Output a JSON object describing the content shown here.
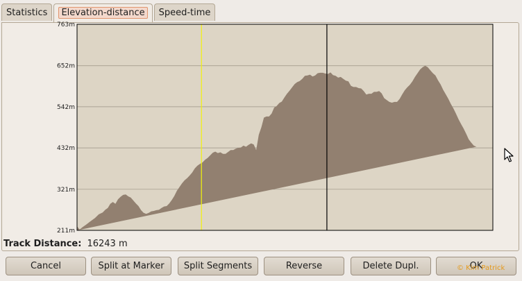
{
  "tabs": [
    {
      "label": "Statistics",
      "active": false
    },
    {
      "label": "Elevation-distance",
      "active": true
    },
    {
      "label": "Speed-time",
      "active": false
    }
  ],
  "track_distance": {
    "label": "Track Distance:",
    "value": "16243 m"
  },
  "buttons": {
    "cancel": "Cancel",
    "split_at_marker": "Split at Marker",
    "split_segments": "Split Segments",
    "reverse": "Reverse",
    "delete_dupl": "Delete Dupl.",
    "ok": "OK"
  },
  "watermark": "© Kim Patrick",
  "colors": {
    "plot_bg": "#ddd5c5",
    "fill": "#928070",
    "marker_yellow": "#f2f20c",
    "marker_black": "#000000"
  },
  "chart_data": {
    "type": "area",
    "y_tick_labels": [
      "763m",
      "652m",
      "542m",
      "432m",
      "321m",
      "211m"
    ],
    "y_ticks": [
      763,
      652,
      542,
      432,
      321,
      211
    ],
    "ylim": [
      211,
      763
    ],
    "xlim": [
      0,
      16243
    ],
    "grid": true,
    "markers": {
      "yellow": 4860,
      "black": 9760
    },
    "x": [
      0,
      100,
      200,
      350,
      500,
      700,
      850,
      1000,
      1100,
      1200,
      1300,
      1400,
      1500,
      1600,
      1700,
      1800,
      1900,
      2000,
      2100,
      2200,
      2300,
      2400,
      2500,
      2600,
      2700,
      2800,
      2900,
      3000,
      3100,
      3200,
      3300,
      3400,
      3500,
      3600,
      3700,
      3800,
      3900,
      4000,
      4100,
      4200,
      4300,
      4400,
      4500,
      4600,
      4700,
      4800,
      4900,
      5000,
      5100,
      5200,
      5300,
      5400,
      5500,
      5600,
      5700,
      5800,
      5900,
      6000,
      6100,
      6200,
      6300,
      6400,
      6500,
      6600,
      6700,
      6800,
      6900,
      7000,
      7100,
      7200,
      7300,
      7400,
      7500,
      7600,
      7700,
      7800,
      7900,
      8000,
      8100,
      8200,
      8300,
      8400,
      8500,
      8600,
      8700,
      8800,
      8900,
      9000,
      9100,
      9200,
      9300,
      9400,
      9500,
      9600,
      9700,
      9800,
      9900,
      10000,
      10100,
      10200,
      10300,
      10400,
      10500,
      10600,
      10700,
      10800,
      10900,
      11000,
      11100,
      11200,
      11300,
      11400,
      11500,
      11600,
      11700,
      11800,
      11900,
      12000,
      12100,
      12200,
      12300,
      12400,
      12500,
      12600,
      12700,
      12800,
      12900,
      13000,
      13100,
      13200,
      13300,
      13400,
      13500,
      13600,
      13700,
      13800,
      13900,
      14000,
      14100,
      14200,
      14300,
      14400,
      14500,
      14600,
      14700,
      14800,
      14900,
      15000,
      15100,
      15200,
      15300,
      15400,
      15500,
      15600,
      15700,
      15800,
      15900,
      16000,
      16100,
      16243
    ],
    "values": [
      222,
      213,
      219,
      226,
      234,
      244,
      254,
      259,
      266,
      271,
      282,
      287,
      282,
      294,
      301,
      306,
      307,
      302,
      299,
      291,
      283,
      276,
      265,
      258,
      255,
      258,
      262,
      263,
      265,
      266,
      271,
      275,
      276,
      283,
      292,
      303,
      317,
      327,
      337,
      345,
      351,
      358,
      366,
      377,
      384,
      389,
      393,
      400,
      405,
      412,
      419,
      422,
      418,
      420,
      416,
      416,
      421,
      426,
      426,
      430,
      432,
      433,
      438,
      435,
      440,
      444,
      441,
      426,
      467,
      487,
      513,
      516,
      516,
      524,
      540,
      544,
      552,
      556,
      567,
      577,
      585,
      594,
      603,
      608,
      611,
      617,
      625,
      626,
      628,
      623,
      626,
      632,
      633,
      633,
      631,
      630,
      634,
      627,
      625,
      620,
      622,
      617,
      612,
      610,
      598,
      595,
      595,
      592,
      591,
      584,
      575,
      577,
      577,
      582,
      582,
      584,
      578,
      565,
      560,
      555,
      553,
      555,
      555,
      563,
      575,
      586,
      594,
      601,
      610,
      622,
      632,
      642,
      648,
      652,
      648,
      640,
      632,
      626,
      613,
      602,
      588,
      576,
      564,
      550,
      538,
      524,
      509,
      496,
      484,
      470,
      455,
      446,
      438,
      435
    ]
  }
}
